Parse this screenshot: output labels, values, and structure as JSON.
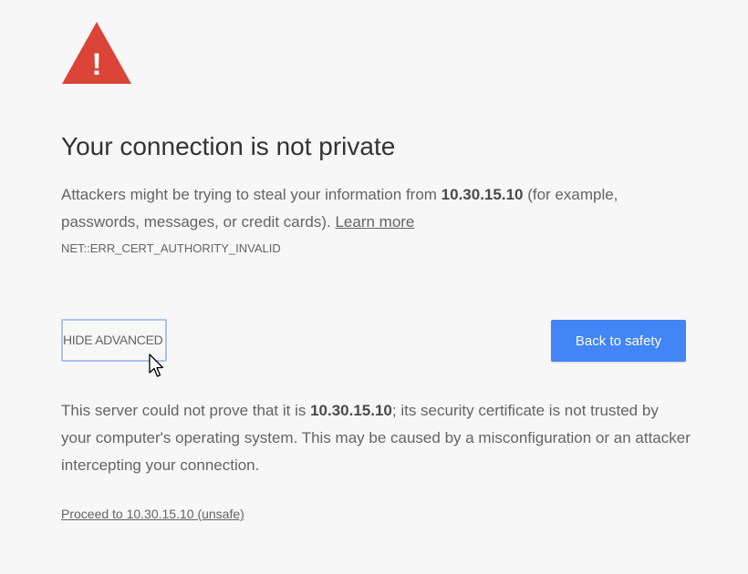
{
  "icon": {
    "name": "warning-triangle-icon",
    "color": "#db4437",
    "glyph": "!"
  },
  "title": "Your connection is not private",
  "message": {
    "part1": "Attackers might be trying to steal your information from ",
    "host": "10.30.15.10",
    "part2": " (for example, passwords, messages, or credit cards). ",
    "learn_more": "Learn more"
  },
  "error_code": "NET::ERR_CERT_AUTHORITY_INVALID",
  "buttons": {
    "hide_advanced": "HIDE ADVANCED",
    "back_to_safety": "Back to safety"
  },
  "details": {
    "part1": "This server could not prove that it is ",
    "host": "10.30.15.10",
    "part2": "; its security certificate is not trusted by your computer's operating system. This may be caused by a misconfiguration or an attacker intercepting your connection."
  },
  "proceed_link": "Proceed to 10.30.15.10 (unsafe)",
  "colors": {
    "primary_button": "#4285f4",
    "warning": "#db4437",
    "focus_border": "#a8c4ef"
  }
}
